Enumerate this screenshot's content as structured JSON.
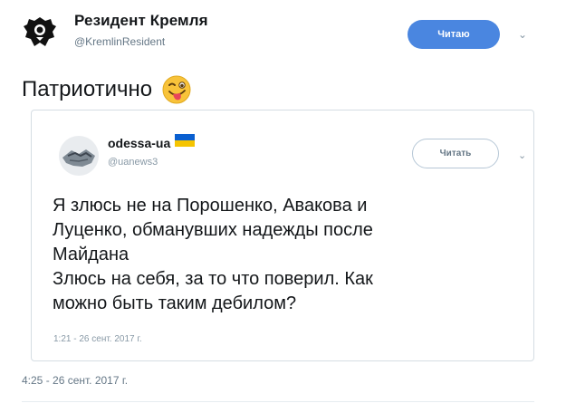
{
  "author": {
    "display_name": "Резидент Кремля",
    "handle": "@KremlinResident",
    "avatar_icon": "eagle-emblem-icon"
  },
  "follow_button": {
    "label": "Читаю"
  },
  "tweet": {
    "text": "Патриотично",
    "emoji_icon": "winking-face-with-tongue-icon",
    "date": "4:25 - 26 сент. 2017 г."
  },
  "quoted": {
    "display_name": "odessa-ua",
    "flag_icon": "ukraine-flag-icon",
    "handle": "@uanews3",
    "avatar_icon": "handshake-photo-icon",
    "follow_label": "Читать",
    "lines": [
      "Я злюсь не на Порошенко, Авакова и",
      "Луценко, обманувших надежды после",
      "Майдана",
      "Злюсь на себя, за то что поверил. Как",
      "можно быть таким дебилом?"
    ],
    "date": "1:21 - 26 сент. 2017 г."
  },
  "colors": {
    "follow_blue": "#4a86e0",
    "text": "#14171a",
    "muted": "#657786",
    "border": "#d5dde3"
  }
}
